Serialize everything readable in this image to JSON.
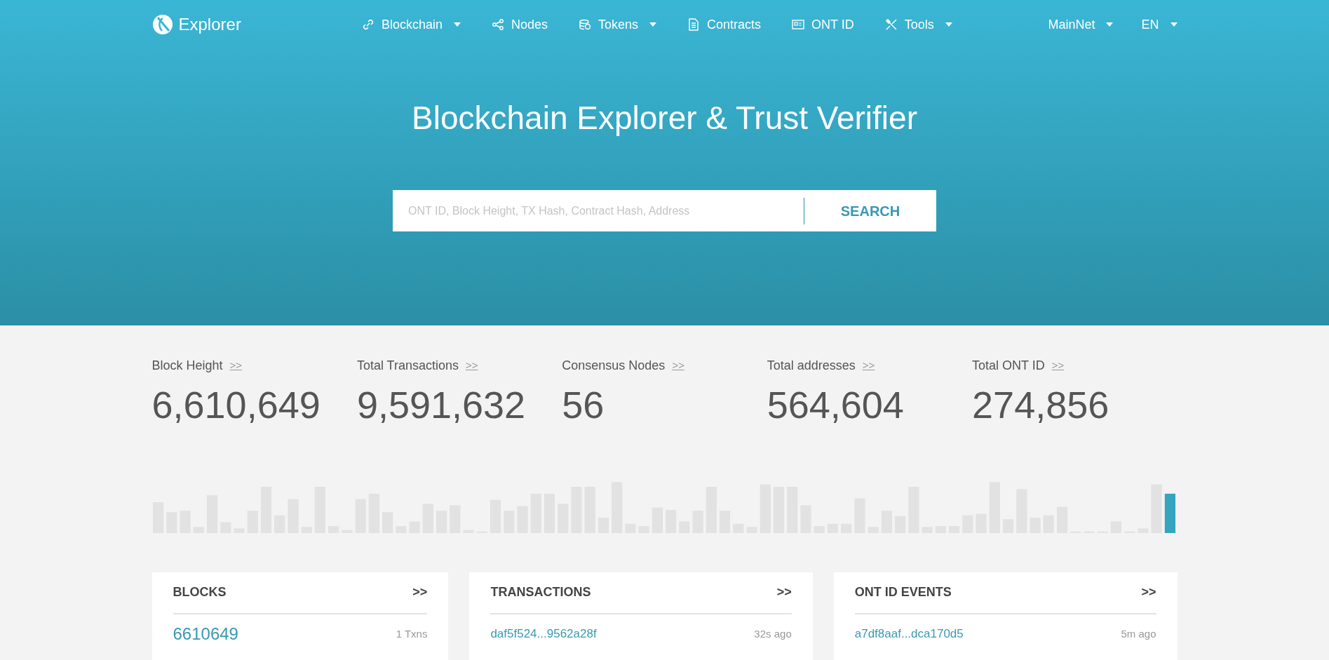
{
  "brand": {
    "name": "Explorer"
  },
  "nav": [
    {
      "label": "Blockchain",
      "dropdown": true
    },
    {
      "label": "Nodes",
      "dropdown": false
    },
    {
      "label": "Tokens",
      "dropdown": true
    },
    {
      "label": "Contracts",
      "dropdown": false
    },
    {
      "label": "ONT ID",
      "dropdown": false
    },
    {
      "label": "Tools",
      "dropdown": true
    }
  ],
  "nav_right": [
    {
      "label": "MainNet"
    },
    {
      "label": "EN"
    }
  ],
  "hero": {
    "title": "Blockchain Explorer & Trust Verifier"
  },
  "search": {
    "placeholder": "ONT ID, Block Height, TX Hash, Contract Hash, Address",
    "button": "SEARCH"
  },
  "stats": [
    {
      "label": "Block Height",
      "more": ">>",
      "value": "6,610,649"
    },
    {
      "label": "Total Transactions",
      "more": ">>",
      "value": "9,591,632"
    },
    {
      "label": "Consensus Nodes",
      "more": ">>",
      "value": "56"
    },
    {
      "label": "Total addresses",
      "more": ">>",
      "value": "564,604"
    },
    {
      "label": "Total ONT ID",
      "more": ">>",
      "value": "274,856"
    }
  ],
  "panels": [
    {
      "title": "BLOCKS",
      "more": ">>",
      "rows": [
        {
          "link": "6610649",
          "meta": "1 Txns",
          "large": true
        }
      ]
    },
    {
      "title": "TRANSACTIONS",
      "more": ">>",
      "rows": [
        {
          "link": "daf5f524...9562a28f",
          "meta": "32s ago",
          "large": false
        }
      ]
    },
    {
      "title": "ONT ID EVENTS",
      "more": ">>",
      "rows": [
        {
          "link": "a7df8aaf...dca170d5",
          "meta": "5m ago",
          "large": false
        }
      ]
    }
  ]
}
